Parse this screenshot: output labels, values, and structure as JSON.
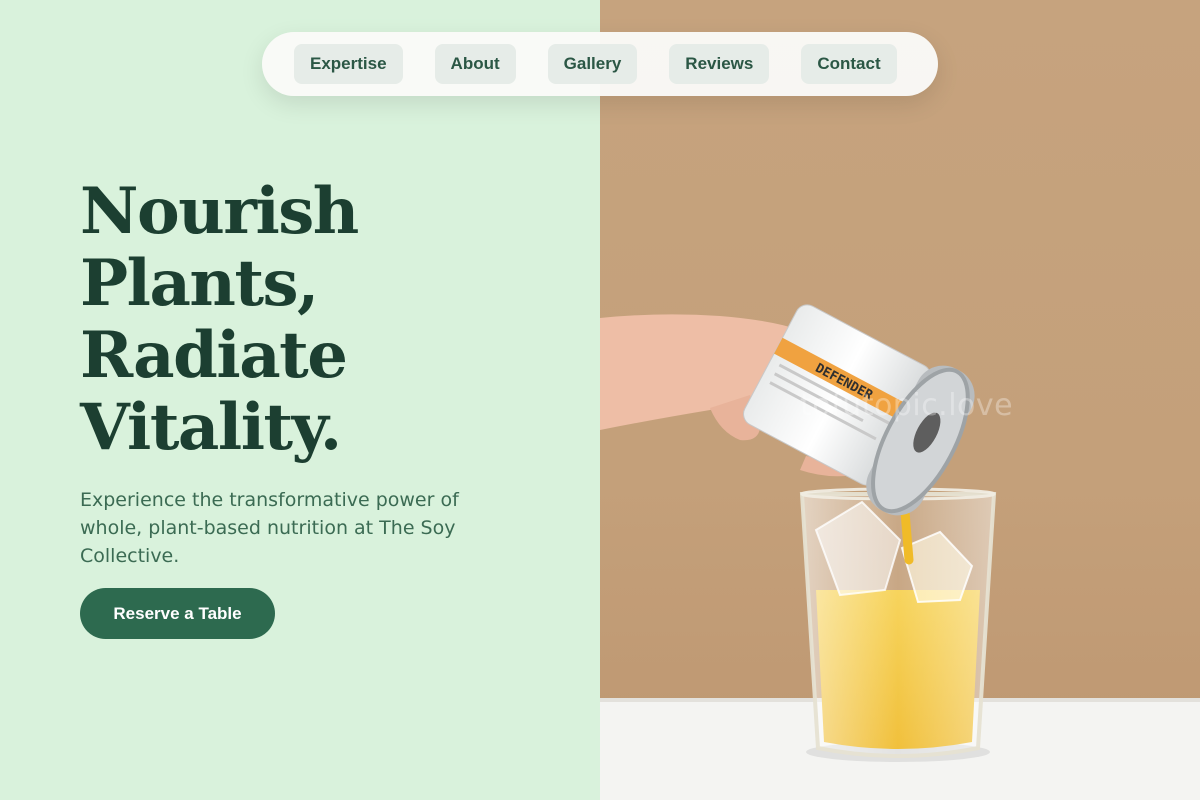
{
  "nav": {
    "items": [
      {
        "label": "Expertise"
      },
      {
        "label": "About"
      },
      {
        "label": "Gallery"
      },
      {
        "label": "Reviews"
      },
      {
        "label": "Contact"
      }
    ]
  },
  "hero": {
    "title_lines": [
      "Nourish",
      "Plants,",
      "Radiate",
      "Vitality."
    ],
    "subtitle": "Experience the transformative power of whole, plant-based nutrition at The Soy Collective.",
    "cta_label": "Reserve a Table"
  },
  "photo": {
    "can_label": "DEFENDER",
    "watermark": "tofutopic.love"
  },
  "colors": {
    "left_bg": "#d9f2dc",
    "heading": "#1c3f31",
    "body_text": "#3b6b53",
    "accent": "#2d6a4f",
    "nav_pill_bg": "#e6ece8",
    "photo_backdrop": "#c6a37e",
    "juice": "#f2c230"
  }
}
